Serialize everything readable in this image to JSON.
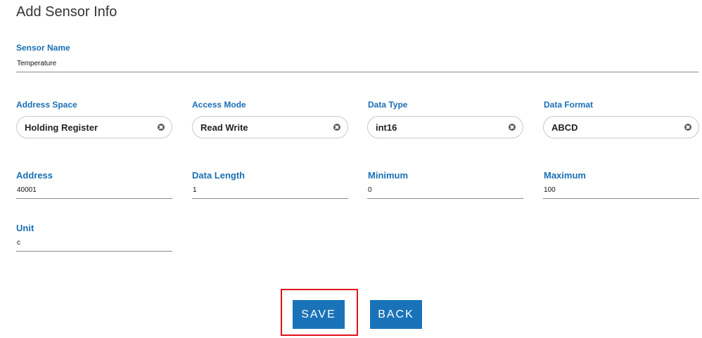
{
  "page": {
    "title": "Add Sensor Info"
  },
  "sensor_name": {
    "label": "Sensor Name",
    "value": "Temperature"
  },
  "address_space": {
    "label": "Address Space",
    "value": "Holding Register"
  },
  "access_mode": {
    "label": "Access Mode",
    "value": "Read Write"
  },
  "data_type": {
    "label": "Data Type",
    "value": "int16"
  },
  "data_format": {
    "label": "Data Format",
    "value": "ABCD"
  },
  "address": {
    "label": "Address",
    "value": "40001"
  },
  "data_length": {
    "label": "Data Length",
    "value": "1"
  },
  "minimum": {
    "label": "Minimum",
    "value": "0"
  },
  "maximum": {
    "label": "Maximum",
    "value": "100"
  },
  "unit": {
    "label": "Unit",
    "value": "c"
  },
  "actions": {
    "save_label": "SAVE",
    "back_label": "BACK"
  },
  "colors": {
    "label": "#1a6fb5",
    "button": "#1a73b8",
    "highlight": "#e0121b"
  }
}
